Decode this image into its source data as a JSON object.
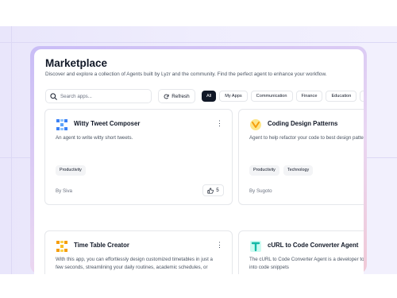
{
  "marketplace": {
    "title": "Marketplace",
    "subtitle": "Discover and explore a collection of Agents built by Lyzr and the community. Find the perfect agent to enhance your workflow."
  },
  "toolbar": {
    "search_placeholder": "Search apps...",
    "refresh_label": "Refresh",
    "filters": [
      "All",
      "My Apps",
      "Communication",
      "Finance",
      "Education",
      "P"
    ],
    "active_filter": "All"
  },
  "cards": [
    {
      "title": "Witty Tweet Composer",
      "icon": "witty-tweet-composer-icon",
      "description": "An agent to write witty short tweets.",
      "tags": [
        "Productivity"
      ],
      "author": "By Siva",
      "likes": "5"
    },
    {
      "title": "Coding Design Patterns",
      "icon": "coding-design-patterns-icon",
      "description": "Agent to help refactor your code to best design patterns and teach you along the way",
      "tags": [
        "Productivity",
        "Technology"
      ],
      "author": "By Sugoto"
    },
    {
      "title": "Time Table Creator",
      "icon": "time-table-creator-icon",
      "description": "With this app, you can effortlessly design customized timetables in just a few seconds, streamlining your daily routines, academic schedules, or"
    },
    {
      "title": "cURL to Code Converter Agent",
      "icon": "curl-converter-icon",
      "description": "The cURL to Code Converter Agent is a developer tool transforming cURL commands into code snippets"
    }
  ],
  "colors": {
    "accent_dark": "#111827",
    "background_band": "#ece9fc",
    "frame_gradient": [
      "#c9bdf6",
      "#f1c9d6"
    ],
    "icon_blue": "#3b82f6",
    "icon_orange": "#f59e0b",
    "icon_teal": "#14b8a6"
  }
}
